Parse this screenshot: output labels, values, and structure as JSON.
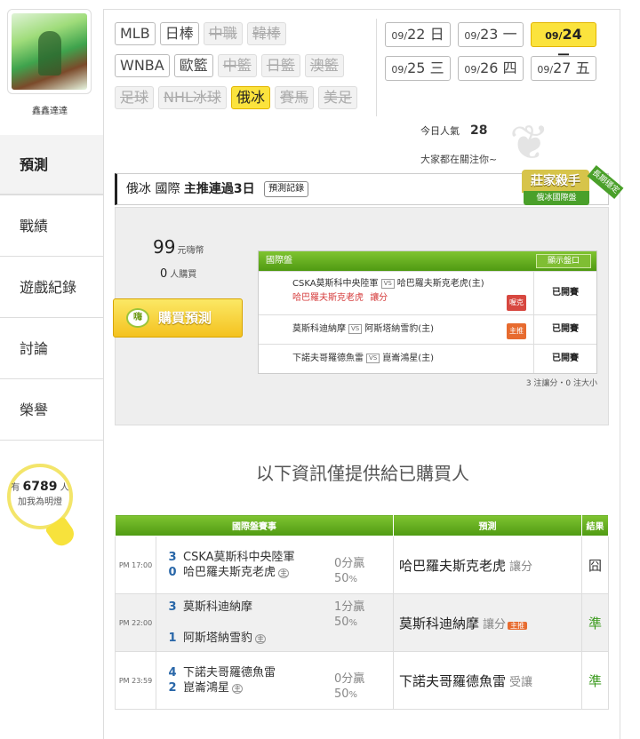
{
  "user": {
    "name": "鑫鑫達達"
  },
  "nav": [
    {
      "label": "預測"
    },
    {
      "label": "戰績"
    },
    {
      "label": "遊戲紀錄"
    },
    {
      "label": "討論"
    },
    {
      "label": "榮譽"
    }
  ],
  "fans": {
    "prefix": "有",
    "count": "6789",
    "suffix": "人",
    "text": "加我為明燈"
  },
  "sports": {
    "row1": [
      {
        "label": "MLB",
        "state": "normal"
      },
      {
        "label": "日棒",
        "state": "normal"
      },
      {
        "label": "中職",
        "state": "dim"
      },
      {
        "label": "韓棒",
        "state": "dim"
      }
    ],
    "row2": [
      {
        "label": "WNBA",
        "state": "normal"
      },
      {
        "label": "歐籃",
        "state": "normal"
      },
      {
        "label": "中籃",
        "state": "dim"
      },
      {
        "label": "日籃",
        "state": "dim"
      },
      {
        "label": "澳籃",
        "state": "dim"
      }
    ],
    "row3": [
      {
        "label": "足球",
        "state": "dim"
      },
      {
        "label": "NHL冰球",
        "state": "dim"
      },
      {
        "label": "俄冰",
        "state": "sel"
      },
      {
        "label": "賽馬",
        "state": "dim"
      },
      {
        "label": "美足",
        "state": "dim"
      }
    ]
  },
  "dates": {
    "row1": [
      {
        "md": "09/",
        "d": "22",
        "w": "日"
      },
      {
        "md": "09/",
        "d": "23",
        "w": "一"
      },
      {
        "md": "09/",
        "d": "24",
        "w": "二",
        "sel": true
      }
    ],
    "row2": [
      {
        "md": "09/",
        "d": "25",
        "w": "三"
      },
      {
        "md": "09/",
        "d": "26",
        "w": "四"
      },
      {
        "md": "09/",
        "d": "27",
        "w": "五"
      }
    ]
  },
  "popularity": {
    "label": "今日人氣",
    "value": "28",
    "follow": "大家都在關注你~"
  },
  "title": {
    "league": "俄冰 國際",
    "streak": "主推連過3日",
    "record_btn": "預測記錄"
  },
  "badge": {
    "main": "莊家殺手",
    "sub": "俄冰國際盤",
    "ribbon": "長期穩定"
  },
  "purchase": {
    "price": "99",
    "price_unit": "元嗨幣",
    "buyers": "0",
    "buyers_unit": "人購買",
    "buy_label": "購買預測",
    "buy_icon": "嗨"
  },
  "intl_box": {
    "title": "國際盤",
    "show_btn": "顯示盤口",
    "rows": [
      {
        "away": "CSKA莫斯科中央陸軍",
        "home": "哈巴羅夫斯克老虎(主)",
        "pick": "哈巴羅夫斯克老虎",
        "pick_type": "讓分",
        "tag": "喔克",
        "status": "已開賽"
      },
      {
        "away": "莫斯科迪納摩",
        "home": "阿斯塔納雪豹(主)",
        "tag": "主推",
        "status": "已開賽"
      },
      {
        "away": "下諾夫哥羅德魚雷",
        "home": "崑崙鴻星(主)",
        "status": "已開賽"
      }
    ],
    "vs": "VS",
    "note": "3 注讓分・0 注大小"
  },
  "only_text": "以下資訊僅提供給已購買人",
  "table": {
    "headers": [
      "國際盤賽事",
      "預測",
      "結果"
    ],
    "rows": [
      {
        "time": "PM 17:00",
        "away_score": "3",
        "away": "CSKA莫斯科中央陸軍",
        "home_score": "0",
        "home": "哈巴羅夫斯克老虎",
        "home_mark": "主",
        "odds": "0分贏",
        "pct": "50",
        "pct_unit": "%",
        "pred": "哈巴羅夫斯克老虎",
        "pred_type": "讓分",
        "result": "囧",
        "result_type": "lose"
      },
      {
        "time": "PM 22:00",
        "away_score": "3",
        "away": "莫斯科迪納摩",
        "home_score": "1",
        "home": "阿斯塔納雪豹",
        "home_mark": "主",
        "odds": "1分贏",
        "pct": "50",
        "pct_unit": "%",
        "pred": "莫斯科迪納摩",
        "pred_type": "讓分",
        "pred_tag": "主推",
        "result": "準",
        "result_type": "win"
      },
      {
        "time": "PM 23:59",
        "away_score": "4",
        "away": "下諾夫哥羅德魚雷",
        "home_score": "2",
        "home": "崑崙鴻星",
        "home_mark": "主",
        "odds": "0分贏",
        "pct": "50",
        "pct_unit": "%",
        "pred": "下諾夫哥羅德魚雷",
        "pred_type": "受讓",
        "result": "準",
        "result_type": "win"
      }
    ]
  },
  "colors": {
    "accent_yellow": "#fbe33d",
    "green": "#4f9a12",
    "win": "#3a9a1c"
  }
}
